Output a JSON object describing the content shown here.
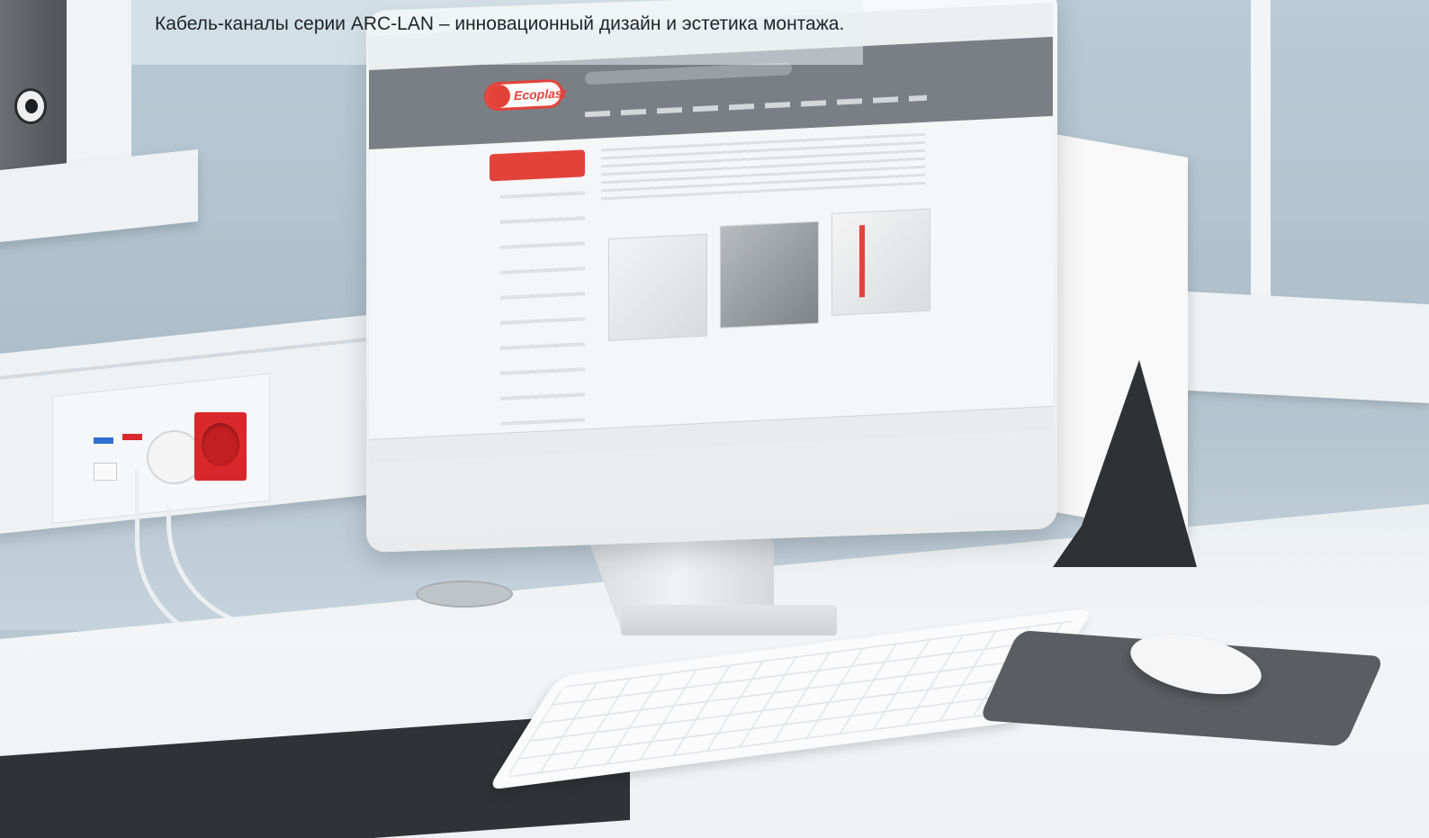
{
  "caption": {
    "text": "Кабель-каналы серии ARC-LAN – инновационный дизайн и эстетика монтажа."
  },
  "photo": {
    "logo_text": "Ecoplast",
    "colors": {
      "wall": "#b7c8d3",
      "desk": "#eef2f4",
      "socket_red": "#d9282b",
      "brand_red": "#e3423a",
      "monitor": "#f3f4f5",
      "mousepad": "#5a5e62"
    }
  }
}
